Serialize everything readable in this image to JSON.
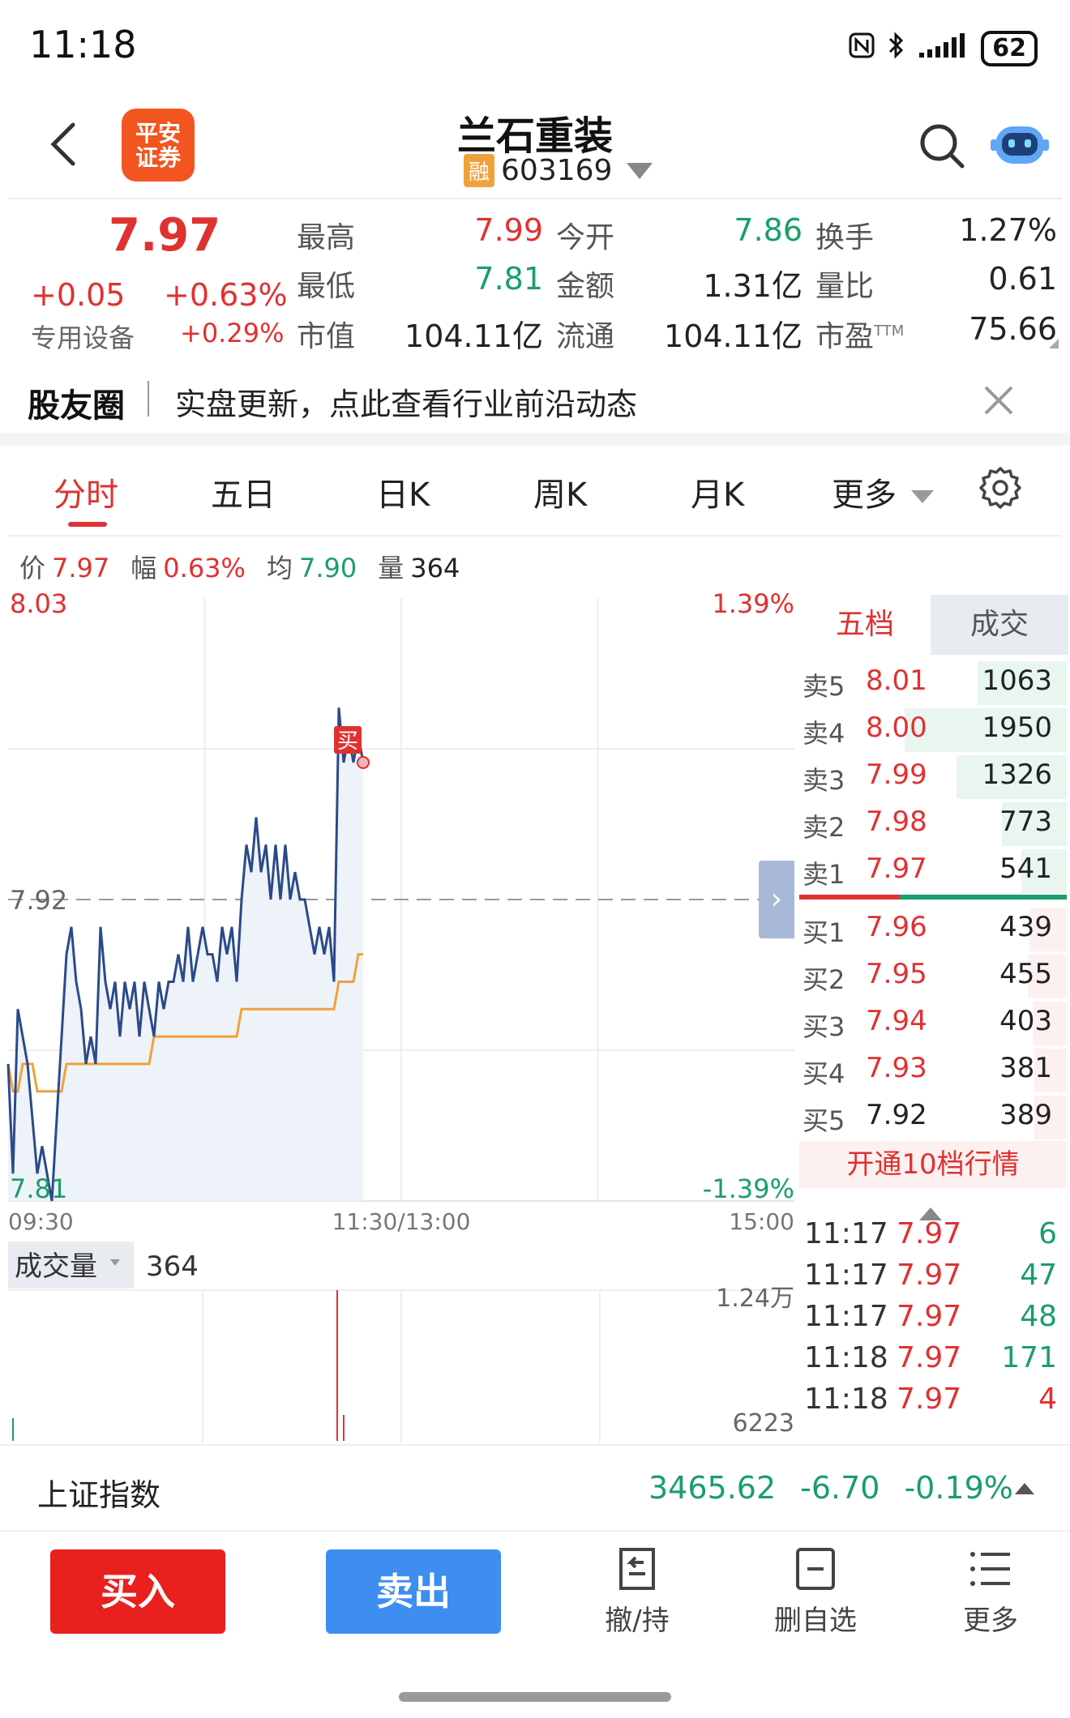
{
  "status_bar": {
    "time": "11:18",
    "battery": "62"
  },
  "header": {
    "logo_text_line1": "平安",
    "logo_text_line2": "证券",
    "stock_name": "兰石重装",
    "margin_badge": "融",
    "stock_code": "603169"
  },
  "quote": {
    "price": "7.97",
    "change": "+0.05",
    "change_pct": "+0.63%",
    "sector": "专用设备",
    "sector_pct": "+0.29%",
    "fields": [
      {
        "label": "最高",
        "value": "7.99",
        "color": "red"
      },
      {
        "label": "今开",
        "value": "7.86",
        "color": "green"
      },
      {
        "label": "换手",
        "value": "1.27%",
        "color": "dark"
      },
      {
        "label": "最低",
        "value": "7.81",
        "color": "green"
      },
      {
        "label": "金额",
        "value": "1.31亿",
        "color": "dark"
      },
      {
        "label": "量比",
        "value": "0.61",
        "color": "dark"
      },
      {
        "label": "市值",
        "value": "104.11亿",
        "color": "dark"
      },
      {
        "label": "流通",
        "value": "104.11亿",
        "color": "dark"
      },
      {
        "label": "市盈",
        "value": "75.66",
        "color": "dark"
      }
    ],
    "pe_suffix": "TTM"
  },
  "community": {
    "title": "股友圈",
    "text": "实盘更新，点此查看行业前沿动态"
  },
  "tabs": [
    {
      "label": "分时",
      "active": true
    },
    {
      "label": "五日",
      "active": false
    },
    {
      "label": "日K",
      "active": false
    },
    {
      "label": "周K",
      "active": false
    },
    {
      "label": "月K",
      "active": false
    },
    {
      "label": "更多",
      "active": false
    }
  ],
  "info_line": {
    "price_label": "价",
    "price": "7.97",
    "amp_label": "幅",
    "amp": "0.63%",
    "avg_label": "均",
    "avg": "7.90",
    "vol_label": "量",
    "vol": "364"
  },
  "chart_data": {
    "type": "line",
    "y_max_label": "8.03",
    "y_mid_label": "7.92",
    "y_min_label": "7.81",
    "pct_max_label": "1.39%",
    "pct_min_label": "-1.39%",
    "x_labels": [
      "09:30",
      "11:30/13:00",
      "15:00"
    ],
    "ylim": [
      7.81,
      8.03
    ],
    "prev_close": 7.92,
    "series": [
      {
        "values": [
          7.86,
          7.82,
          7.88,
          7.87,
          7.86,
          7.84,
          7.82,
          7.83,
          7.82,
          7.81,
          7.84,
          7.87,
          7.9,
          7.91,
          7.89,
          7.88,
          7.86,
          7.87,
          7.86,
          7.91,
          7.89,
          7.88,
          7.89,
          7.87,
          7.89,
          7.88,
          7.89,
          7.87,
          7.89,
          7.88,
          7.87,
          7.89,
          7.88,
          7.89,
          7.89,
          7.9,
          7.89,
          7.91,
          7.89,
          7.9,
          7.91,
          7.9,
          7.9,
          7.89,
          7.91,
          7.9,
          7.91,
          7.89,
          7.92,
          7.94,
          7.93,
          7.95,
          7.93,
          7.94,
          7.92,
          7.94,
          7.92,
          7.94,
          7.92,
          7.93,
          7.92,
          7.92,
          7.91,
          7.9,
          7.91,
          7.9,
          7.91,
          7.89,
          7.99,
          7.97,
          7.98,
          7.97,
          7.98,
          7.97
        ]
      },
      {
        "values": [
          7.86,
          7.85,
          7.85,
          7.86,
          7.86,
          7.86,
          7.85,
          7.85,
          7.85,
          7.85,
          7.85,
          7.85,
          7.86,
          7.86,
          7.86,
          7.86,
          7.86,
          7.86,
          7.86,
          7.86,
          7.86,
          7.86,
          7.86,
          7.86,
          7.86,
          7.86,
          7.86,
          7.86,
          7.86,
          7.86,
          7.87,
          7.87,
          7.87,
          7.87,
          7.87,
          7.87,
          7.87,
          7.87,
          7.87,
          7.87,
          7.87,
          7.87,
          7.87,
          7.87,
          7.87,
          7.87,
          7.87,
          7.87,
          7.88,
          7.88,
          7.88,
          7.88,
          7.88,
          7.88,
          7.88,
          7.88,
          7.88,
          7.88,
          7.88,
          7.88,
          7.88,
          7.88,
          7.88,
          7.88,
          7.88,
          7.88,
          7.88,
          7.88,
          7.89,
          7.89,
          7.89,
          7.89,
          7.9,
          7.9
        ]
      }
    ],
    "buy_marker": "买",
    "volume": {
      "label": "成交量",
      "current": "364",
      "y_max_label": "1.24万",
      "y_mid_label": "6223"
    }
  },
  "depth": {
    "tab_book": "五档",
    "tab_trades": "成交",
    "asks": [
      {
        "level": "卖5",
        "price": "8.01",
        "volume": "1063",
        "frac": 0.55
      },
      {
        "level": "卖4",
        "price": "8.00",
        "volume": "1950",
        "frac": 1.0
      },
      {
        "level": "卖3",
        "price": "7.99",
        "volume": "1326",
        "frac": 0.68
      },
      {
        "level": "卖2",
        "price": "7.98",
        "volume": "773",
        "frac": 0.4
      },
      {
        "level": "卖1",
        "price": "7.97",
        "volume": "541",
        "frac": 0.28
      }
    ],
    "bids": [
      {
        "level": "买1",
        "price": "7.96",
        "volume": "439",
        "frac": 0.23
      },
      {
        "level": "买2",
        "price": "7.95",
        "volume": "455",
        "frac": 0.24
      },
      {
        "level": "买3",
        "price": "7.94",
        "volume": "403",
        "frac": 0.21
      },
      {
        "level": "买4",
        "price": "7.93",
        "volume": "381",
        "frac": 0.2
      },
      {
        "level": "买5",
        "price": "7.92",
        "volume": "389",
        "frac": 0.2
      }
    ],
    "open_10": "开通10档行情"
  },
  "trades": [
    {
      "time": "11:17",
      "price": "7.97",
      "volume": "6",
      "color": "green"
    },
    {
      "time": "11:17",
      "price": "7.97",
      "volume": "47",
      "color": "green"
    },
    {
      "time": "11:17",
      "price": "7.97",
      "volume": "48",
      "color": "green"
    },
    {
      "time": "11:18",
      "price": "7.97",
      "volume": "171",
      "color": "green"
    },
    {
      "time": "11:18",
      "price": "7.97",
      "volume": "4",
      "color": "red"
    }
  ],
  "index_ticker": {
    "name": "上证指数",
    "value": "3465.62",
    "change": "-6.70",
    "change_pct": "-0.19%"
  },
  "actions": {
    "buy": "买入",
    "sell": "卖出",
    "cancel_hold": "撤/持",
    "remove_watch": "删自选",
    "more": "更多"
  },
  "colors": {
    "up": "#e03131",
    "down": "#1a9e6a",
    "price_line": "#2b4a8a",
    "avg_line": "#f0a23a"
  }
}
